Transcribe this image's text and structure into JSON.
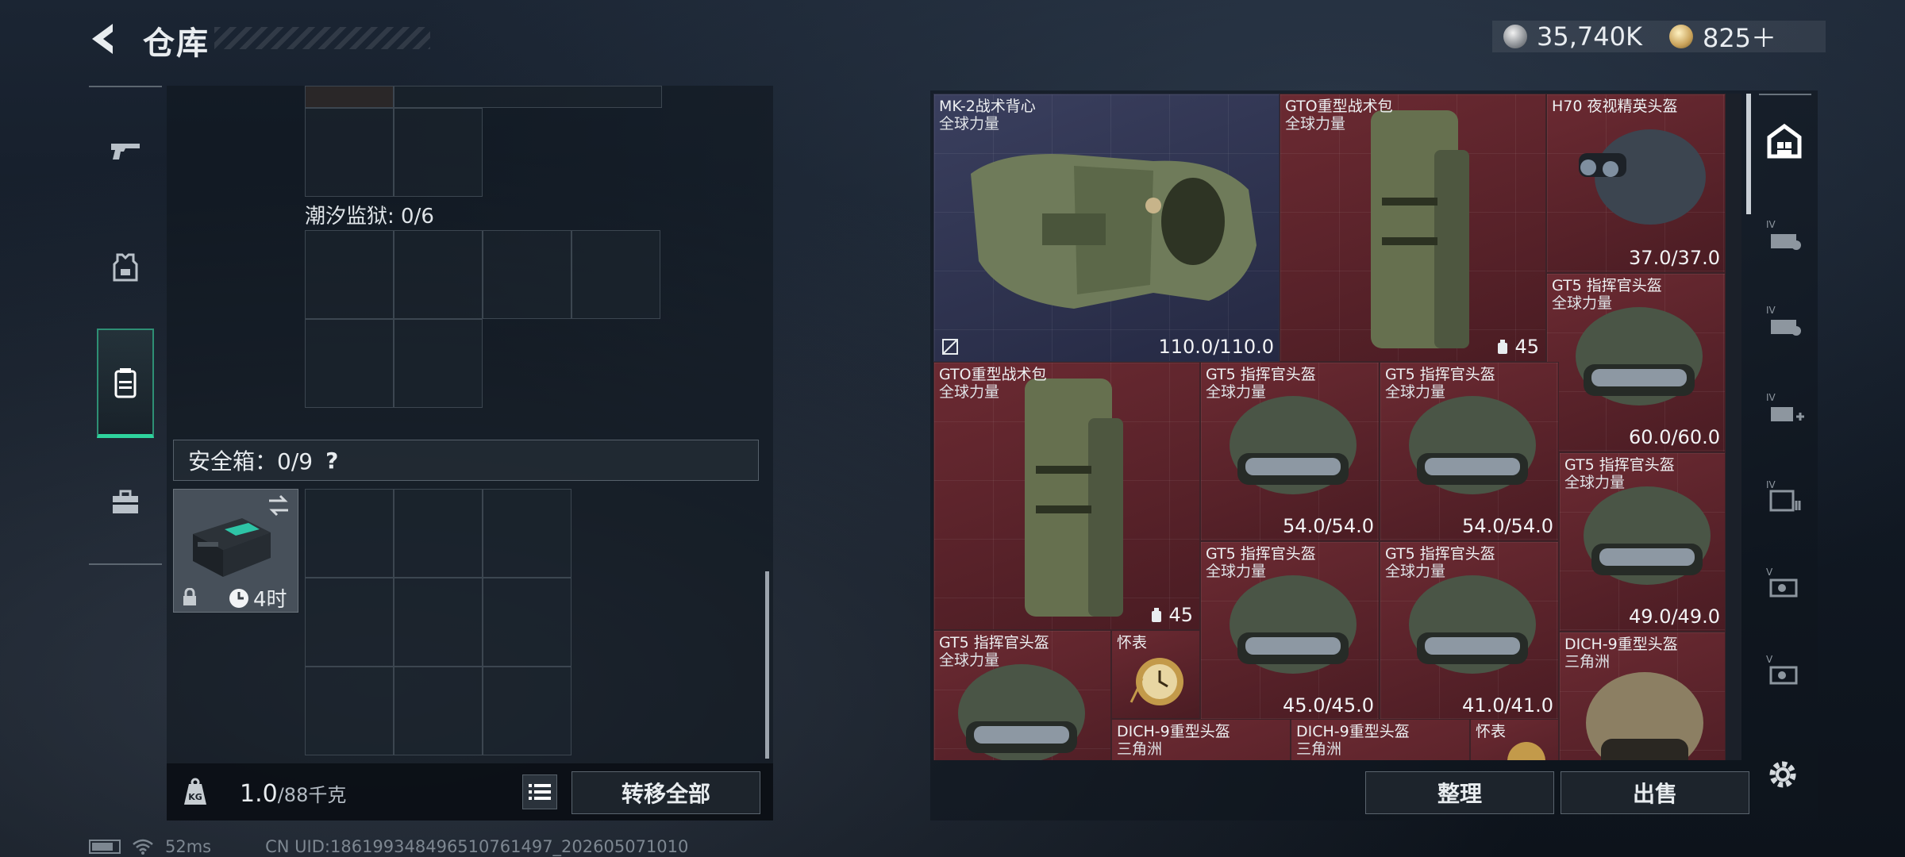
{
  "header": {
    "title": "仓库",
    "silver_amount": "35,740K",
    "gold_amount": "825＋"
  },
  "left": {
    "prison_label": "潮汐监狱: 0/6",
    "safe_label": "安全箱：0/9",
    "safe_help": "?",
    "safe_timer": "4时",
    "weight_value": "1.0",
    "weight_unit": "/88千克",
    "transfer_all": "转移全部"
  },
  "items": [
    {
      "name": "MK-2战术背心",
      "sub": "全球力量",
      "dur": "110.0/110.0"
    },
    {
      "name": "GTO重型战术包",
      "sub": "全球力量",
      "cap": "45"
    },
    {
      "name": "H70 夜视精英头盔",
      "sub": "",
      "dur": "37.0/37.0"
    },
    {
      "name": "GT5 指挥官头盔",
      "sub": "全球力量",
      "dur": "60.0/60.0"
    },
    {
      "name": "GTO重型战术包",
      "sub": "全球力量",
      "cap": "45"
    },
    {
      "name": "GT5 指挥官头盔",
      "sub": "全球力量",
      "dur": "54.0/54.0"
    },
    {
      "name": "GT5 指挥官头盔",
      "sub": "全球力量",
      "dur": "54.0/54.0"
    },
    {
      "name": "GT5 指挥官头盔",
      "sub": "全球力量",
      "dur": "49.0/49.0"
    },
    {
      "name": "GT5 指挥官头盔",
      "sub": "全球力量",
      "dur": "45.0/45.0"
    },
    {
      "name": "GT5 指挥官头盔",
      "sub": "全球力量",
      "dur": "41.0/41.0"
    },
    {
      "name": "GT5 指挥官头盔",
      "sub": "全球力量",
      "dur": ""
    },
    {
      "name": "怀表",
      "sub": "",
      "dur": ""
    },
    {
      "name": "DICH-9重型头盔",
      "sub": "三角洲",
      "dur": ""
    },
    {
      "name": "DICH-9重型头盔",
      "sub": "三角洲",
      "dur": ""
    },
    {
      "name": "DICH-9重型头盔",
      "sub": "三角洲",
      "dur": ""
    },
    {
      "name": "怀表",
      "sub": "",
      "dur": ""
    }
  ],
  "actions": {
    "organize": "整理",
    "sell": "出售"
  },
  "status": {
    "ping": "52ms",
    "uid": "CN UID:186199348496510761497_202605071010"
  },
  "colors": {
    "accent_green": "#2ed39d",
    "tile_red": "#5a222a",
    "tile_navy": "#2e3350"
  }
}
